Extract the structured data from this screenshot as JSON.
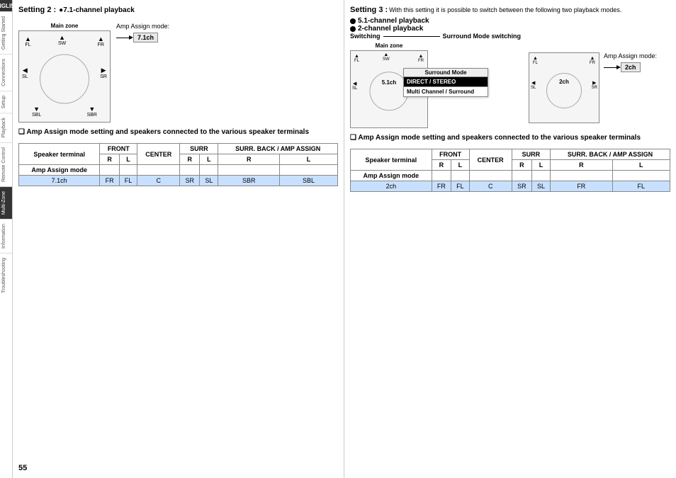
{
  "sidebar": {
    "english_tab": "ENGLISH",
    "items": [
      {
        "label": "Getting Started",
        "active": false
      },
      {
        "label": "Connections",
        "active": false
      },
      {
        "label": "Setup",
        "active": false
      },
      {
        "label": "Playback",
        "active": false
      },
      {
        "label": "Remote Control",
        "active": false
      },
      {
        "label": "Multi-Zone",
        "active": true
      },
      {
        "label": "Information",
        "active": false
      },
      {
        "label": "Troubleshooting",
        "active": false
      }
    ]
  },
  "setting2": {
    "title": "Setting 2 :",
    "subtitle": "●7.1-channel playback",
    "diagram_label": "Main zone",
    "amp_assign_label": "Amp Assign mode:",
    "amp_assign_value": "7.1ch",
    "speakers": [
      "FL",
      "SW",
      "FR",
      "SL",
      "SR",
      "SBL",
      "SBR"
    ],
    "section_header": "❑ Amp Assign mode setting and speakers connected to the various speaker terminals",
    "table": {
      "col1": "Speaker terminal",
      "col2": "FRONT",
      "col3": "CENTER",
      "col4": "SURR",
      "col5": "SURR. BACK / AMP ASSIGN",
      "sub_col2a": "R",
      "sub_col2b": "L",
      "sub_col4a": "R",
      "sub_col4b": "L",
      "sub_col5a": "R",
      "sub_col5b": "L",
      "row_label": "Amp Assign mode",
      "row1_mode": "7.1ch",
      "row1_fr": "FR",
      "row1_fl": "FL",
      "row1_c": "C",
      "row1_sr": "SR",
      "row1_sl": "SL",
      "row1_sbr": "SBR",
      "row1_sbl": "SBL"
    }
  },
  "setting3": {
    "title": "Setting 3 :",
    "description": "With this setting it is possible to switch between the following two playback modes.",
    "bullet1": "●5.1-channel playback",
    "bullet2": "●2-channel playback",
    "switching_label": "Switching",
    "surround_label": "Surround Mode switching",
    "main_zone_label": "Main zone",
    "surround_mode_title": "Surround Mode",
    "mode_option1": "DIRECT / STEREO",
    "mode_option2": "Multi Channel / Surround",
    "diagram1_label": "5.1ch",
    "diagram2_label": "2ch",
    "amp_assign_label": "Amp Assign mode:",
    "amp_assign_value": "2ch",
    "section_header": "❑ Amp Assign mode setting and speakers connected to the various speaker terminals",
    "table": {
      "col1": "Speaker terminal",
      "col2": "FRONT",
      "col3": "CENTER",
      "col4": "SURR",
      "col5": "SURR. BACK / AMP ASSIGN",
      "sub_col2a": "R",
      "sub_col2b": "L",
      "sub_col4a": "R",
      "sub_col4b": "L",
      "sub_col5a": "R",
      "sub_col5b": "L",
      "row_label": "Amp Assign mode",
      "row1_mode": "2ch",
      "row1_fr": "FR",
      "row1_fl": "FL",
      "row1_c": "C",
      "row1_sr": "SR",
      "row1_sl": "SL",
      "row1_sbr": "FR",
      "row1_sbl": "FL"
    }
  },
  "page_number": "55"
}
